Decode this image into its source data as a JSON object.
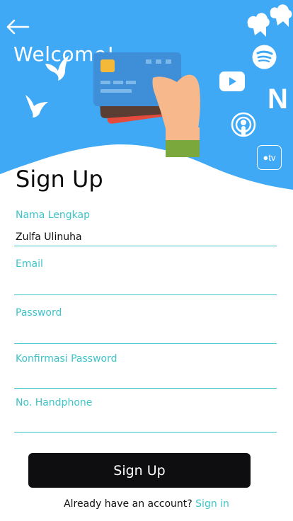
{
  "header": {
    "welcome": "Welcome!",
    "background_color": "#3fa9f5",
    "icons": [
      "back-arrow-icon",
      "bird-icon",
      "credit-card-icon",
      "spotify-icon",
      "youtube-icon",
      "netflix-icon",
      "podcast-icon",
      "apple-tv-icon"
    ],
    "appletv_label": "tv",
    "netflix_label": "N"
  },
  "form": {
    "title": "Sign Up",
    "accent_color": "#3ec3c8",
    "fields": [
      {
        "label": "Nama Lengkap",
        "value": "Zulfa Ulinuha"
      },
      {
        "label": "Email",
        "value": ""
      },
      {
        "label": "Password",
        "value": ""
      },
      {
        "label": "Konfirmasi Password",
        "value": ""
      },
      {
        "label": "No. Handphone",
        "value": ""
      }
    ],
    "submit_label": "Sign Up"
  },
  "footer": {
    "prompt": "Already have an account?",
    "link": "Sign in"
  }
}
